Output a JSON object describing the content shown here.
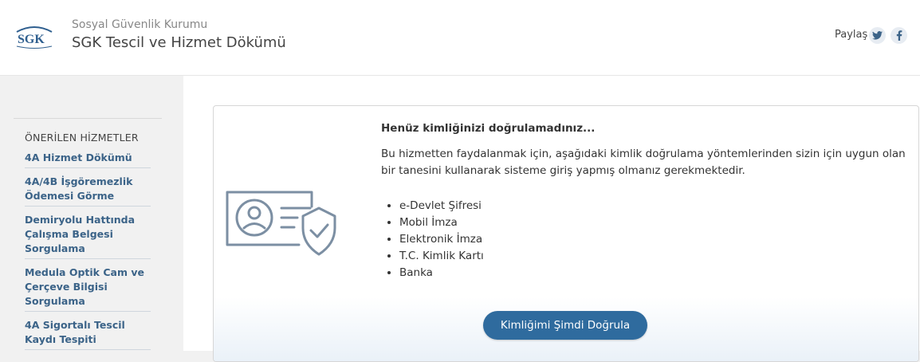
{
  "header": {
    "logo_text": "SGK",
    "org_name": "Sosyal Güvenlik Kurumu",
    "app_title": "SGK Tescil ve Hizmet Dökümü",
    "share_label": "Paylaş",
    "social_icons": [
      "twitter-icon",
      "facebook-icon"
    ]
  },
  "sidebar": {
    "heading": "ÖNERİLEN HİZMETLER",
    "items": [
      {
        "label": "4A Hizmet Dökümü"
      },
      {
        "label": "4A/4B İşgöremezlik Ödemesi Görme"
      },
      {
        "label": "Demiryolu Hattında Çalışma Belgesi Sorgulama"
      },
      {
        "label": "Medula Optik Cam ve Çerçeve Bilgisi Sorgulama"
      },
      {
        "label": "4A Sigortalı Tescil Kaydı Tespiti"
      }
    ]
  },
  "card": {
    "heading": "Henüz kimliğinizi doğrulamadınız...",
    "text": "Bu hizmetten faydalanmak için, aşağıdaki kimlik doğrulama yöntemlerinden sizin için uygun olan bir tanesini kullanarak sisteme giriş yapmış olmanız gerekmektedir.",
    "methods": [
      "e-Devlet Şifresi",
      "Mobil İmza",
      "Elektronik İmza",
      "T.C. Kimlik Kartı",
      "Banka"
    ],
    "button_label": "Kimliğimi Şimdi Doğrula"
  },
  "colors": {
    "link": "#3b6388",
    "button": "#2f6b9e",
    "illustration": "#7c8fa3"
  }
}
